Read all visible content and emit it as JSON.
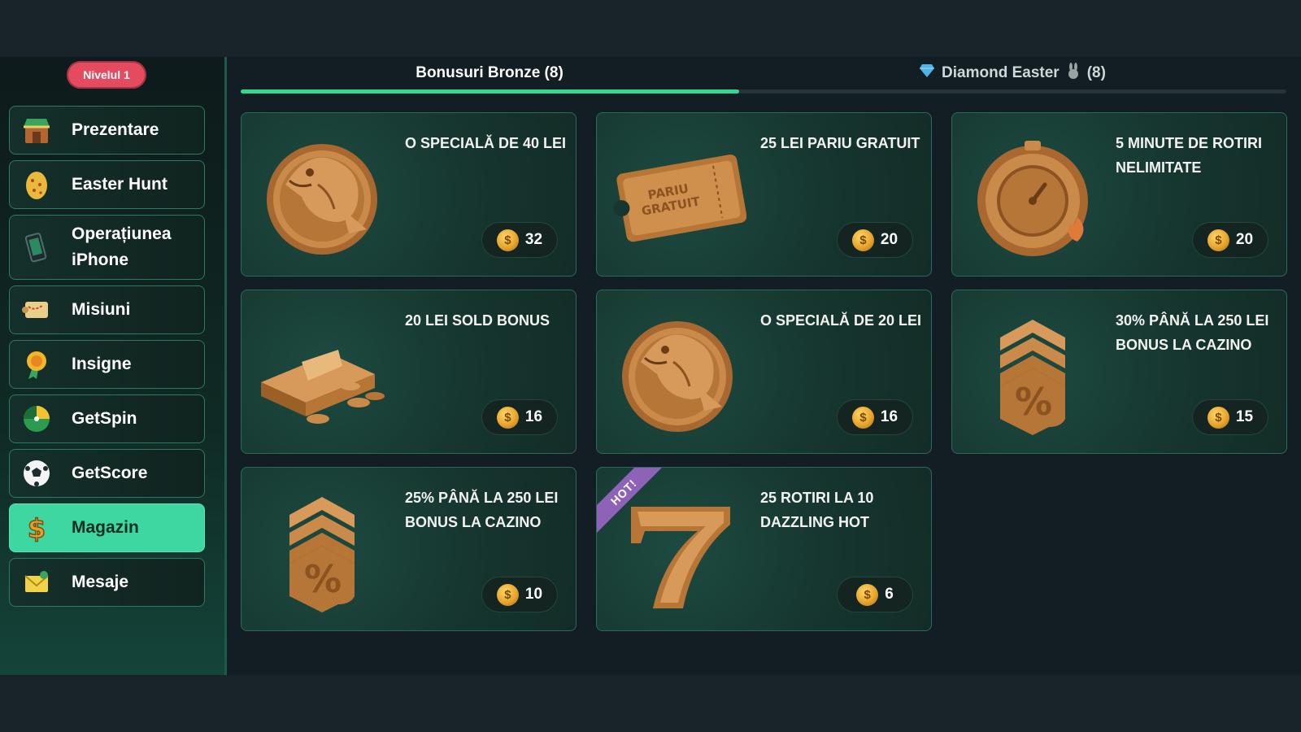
{
  "sidebar": {
    "level_badge": "Nivelul 1",
    "items": [
      {
        "label": "Prezentare",
        "icon": "shop-stall-icon"
      },
      {
        "label": "Easter Hunt",
        "icon": "easter-egg-icon"
      },
      {
        "label": "Operațiunea iPhone",
        "icon": "phone-icon"
      },
      {
        "label": "Misiuni",
        "icon": "map-scroll-icon"
      },
      {
        "label": "Insigne",
        "icon": "medal-icon"
      },
      {
        "label": "GetSpin",
        "icon": "spin-wheel-icon"
      },
      {
        "label": "GetScore",
        "icon": "soccer-ball-icon"
      },
      {
        "label": "Magazin",
        "icon": "dollar-icon",
        "active": true
      },
      {
        "label": "Mesaje",
        "icon": "envelope-icon"
      }
    ]
  },
  "tabs": [
    {
      "label": "Bonusuri Bronze (8)",
      "active": true
    },
    {
      "label": "Diamond Easter",
      "count": "(8)",
      "icons": [
        "diamond-icon",
        "bunny-icon"
      ]
    }
  ],
  "products": [
    {
      "title": "O SPECIALĂ DE 40 LEI",
      "price": "32",
      "art": "fish-medallion-icon"
    },
    {
      "title": "25 LEI PARIU GRATUIT",
      "price": "20",
      "art": "ticket-icon",
      "art_text": "PARIU GRATUIT"
    },
    {
      "title": "5 MINUTE DE ROTIRI NELIMITATE",
      "price": "20",
      "art": "stopwatch-icon"
    },
    {
      "title": "20 LEI SOLD BONUS",
      "price": "16",
      "art": "cash-stack-icon"
    },
    {
      "title": "O SPECIALĂ DE 20 LEI",
      "price": "16",
      "art": "fish-medallion-icon"
    },
    {
      "title": "30% PÂNĂ LA 250 LEI BONUS LA CAZINO",
      "price": "15",
      "art": "percent-chevrons-icon"
    },
    {
      "title": "25% PÂNĂ LA 250 LEI BONUS LA CAZINO",
      "price": "10",
      "art": "percent-chevrons-icon"
    },
    {
      "title": "25 ROTIRI LA 10 DAZZLING HOT",
      "price": "6",
      "art": "lucky-seven-icon",
      "ribbon": "HOT!"
    }
  ],
  "coin_symbol": "$",
  "colors": {
    "accent": "#3fd7a1",
    "tab_progress": "#35d690",
    "badge": "#e54b5f",
    "bronze": "#c98a4a",
    "hot_ribbon": "#8e62b6"
  }
}
